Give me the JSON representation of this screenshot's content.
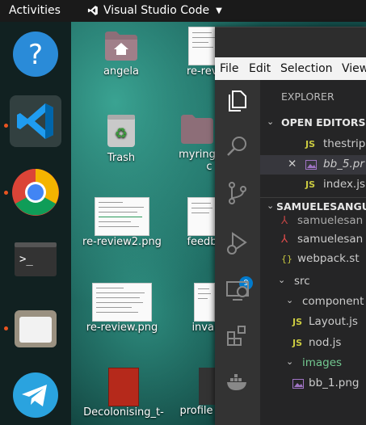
{
  "topbar": {
    "activities": "Activities",
    "app_name": "Visual Studio Code"
  },
  "dock": {
    "items": [
      "help",
      "visual-studio-code",
      "chrome",
      "terminal",
      "files",
      "telegram"
    ]
  },
  "desktop": {
    "icons": [
      {
        "label": "angela"
      },
      {
        "label": "re-revi"
      },
      {
        "label": "Trash"
      },
      {
        "label": "myring"
      },
      {
        "label": "c"
      },
      {
        "label": "re-review2.png"
      },
      {
        "label": "feedb"
      },
      {
        "label": "re-review.png"
      },
      {
        "label": "inval"
      },
      {
        "label": "Decolonising_t-"
      },
      {
        "label": "profile"
      }
    ]
  },
  "vscode": {
    "menu": [
      "File",
      "Edit",
      "Selection",
      "View"
    ],
    "scm_badge": "9",
    "explorer_title": "EXPLORER",
    "open_editors_title": "OPEN EDITORS",
    "open_editors": [
      {
        "name": "thestrip",
        "prefix": "JS"
      },
      {
        "name": "bb_5.pr",
        "prefix": "img"
      },
      {
        "name": "index.js",
        "prefix": "JS"
      }
    ],
    "workspace_title": "SAMUELESANGU",
    "tree": [
      {
        "name": "samuelesan"
      },
      {
        "name": "samuelesan"
      },
      {
        "name": "webpack.st"
      },
      {
        "name": "src"
      },
      {
        "name": "component"
      },
      {
        "name": "Layout.js"
      },
      {
        "name": "nod.js"
      },
      {
        "name": "images"
      },
      {
        "name": "bb_1.png"
      }
    ]
  },
  "colors": {
    "accent": "#e95420",
    "vscode_blue": "#007acc",
    "js_yellow": "#cbcb41",
    "folder_text": "#cccccc"
  }
}
